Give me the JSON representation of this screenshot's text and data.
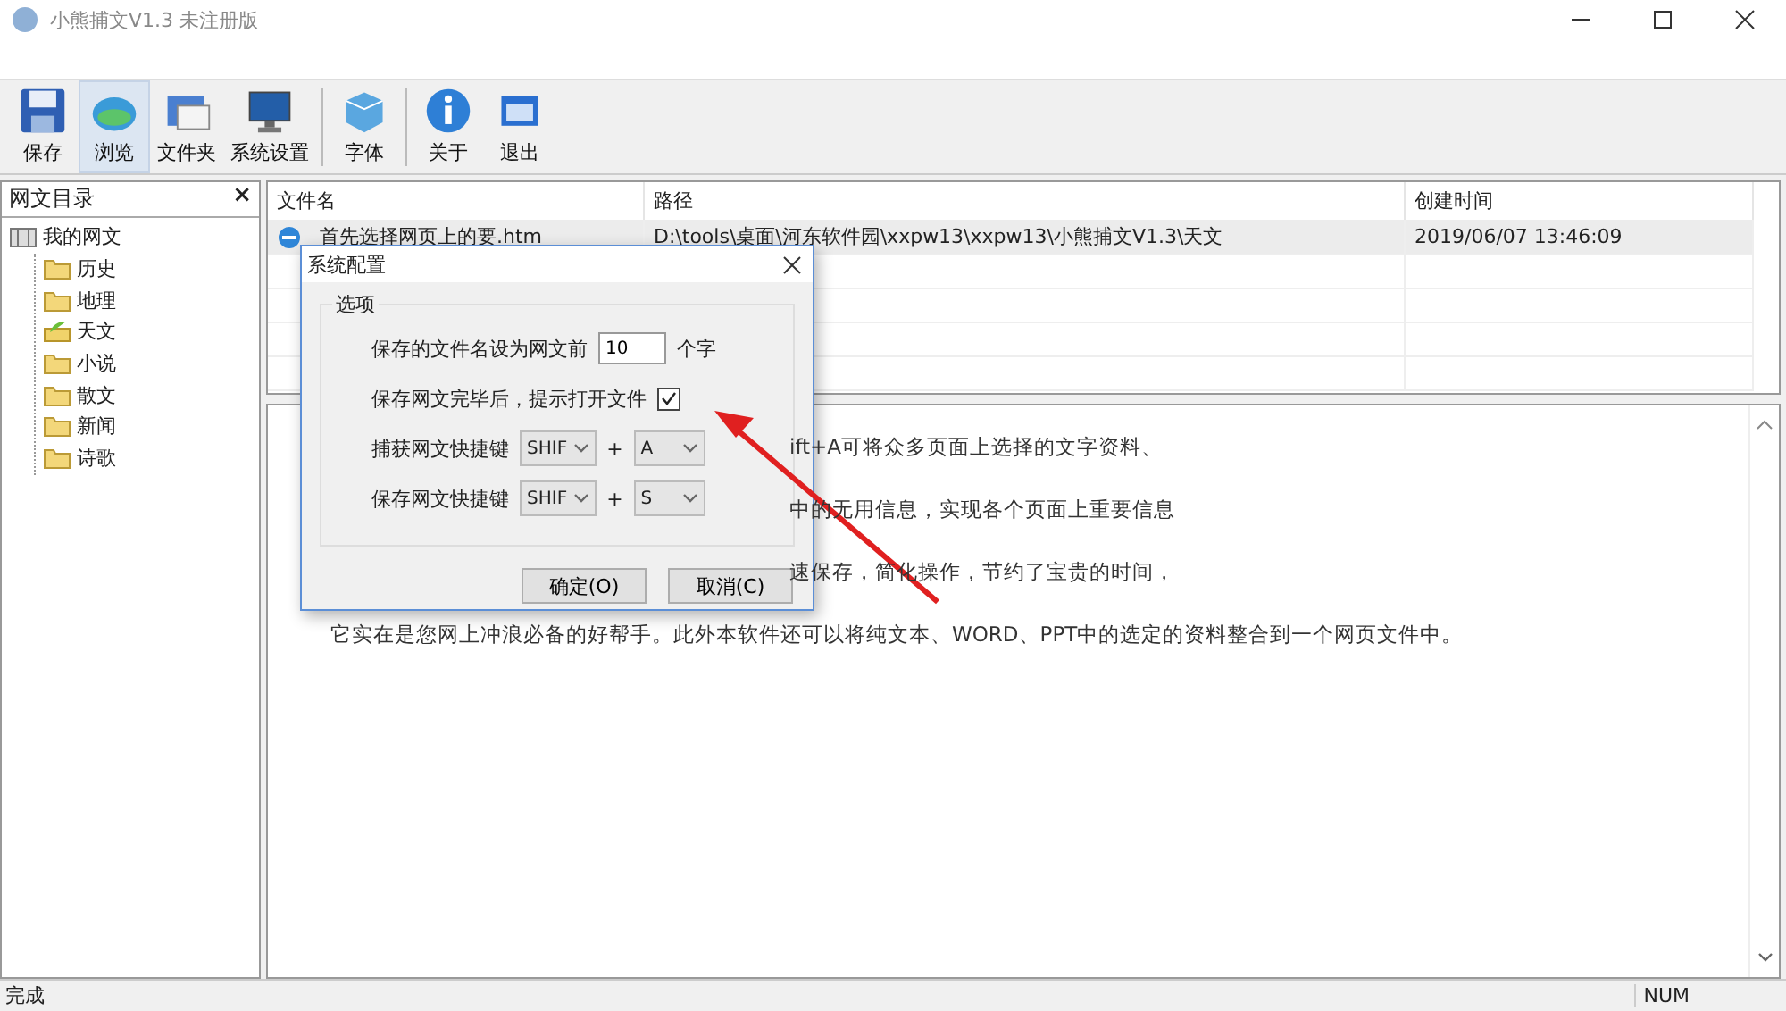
{
  "window": {
    "title": "小熊捕文V1.3 未注册版"
  },
  "toolbar": [
    {
      "label": "保存",
      "kind": "floppy",
      "selected": false
    },
    {
      "label": "浏览",
      "kind": "globe",
      "selected": true
    },
    {
      "label": "文件夹",
      "kind": "folder",
      "selected": false
    },
    {
      "label": "系统设置",
      "kind": "monitor",
      "selected": false
    },
    {
      "label": "字体",
      "kind": "palette",
      "selected": false
    },
    {
      "label": "关于",
      "kind": "info",
      "selected": false
    },
    {
      "label": "退出",
      "kind": "exit",
      "selected": false
    }
  ],
  "tree": {
    "title": "网文目录",
    "close": "×",
    "root": {
      "label": "我的网文",
      "children": [
        {
          "label": "历史",
          "selected": false
        },
        {
          "label": "地理",
          "selected": false
        },
        {
          "label": "天文",
          "selected": true
        },
        {
          "label": "小说",
          "selected": false
        },
        {
          "label": "散文",
          "selected": false
        },
        {
          "label": "新闻",
          "selected": false
        },
        {
          "label": "诗歌",
          "selected": false
        }
      ]
    }
  },
  "file_list": {
    "columns": [
      "文件名",
      "路径",
      "创建时间"
    ],
    "rows": [
      {
        "selected": true,
        "cells": [
          "首先选择网页上的要.htm",
          "D:\\tools\\桌面\\河东软件园\\xxpw13\\xxpw13\\小熊捕文V1.3\\天文",
          "2019/06/07 13:46:09"
        ]
      }
    ]
  },
  "content": {
    "lines": [
      {
        "kind": "partial",
        "text": "ift+A可将众多页面上选择的文字资料、"
      },
      {
        "kind": "partial",
        "text": "中的无用信息，实现各个页面上重要信息"
      },
      {
        "kind": "partial",
        "text": "速保存，简化操作，节约了宝贵的时间，"
      },
      {
        "kind": "full",
        "text": "它实在是您网上冲浪必备的好帮手。此外本软件还可以将纯文本、WORD、PPT中的选定的资料整合到一个网页文件中。"
      }
    ]
  },
  "dialog": {
    "title": "系统配置",
    "group": "选项",
    "name_length": {
      "label": "保存的文件名设为网文前",
      "value": "10",
      "unit": "个字"
    },
    "open_prompt": {
      "label": "保存网文完毕后，提示打开文件",
      "checked": true
    },
    "shortcuts": [
      {
        "label": "捕获网文快捷键",
        "modifier": "SHIF",
        "plus": "+",
        "key": "A"
      },
      {
        "label": "保存网文快捷键",
        "modifier": "SHIF",
        "plus": "+",
        "key": "S"
      }
    ],
    "buttons": [
      "确定(O)",
      "取消(C)"
    ]
  },
  "status_bar": {
    "text": "完成",
    "indicator": "NUM"
  }
}
